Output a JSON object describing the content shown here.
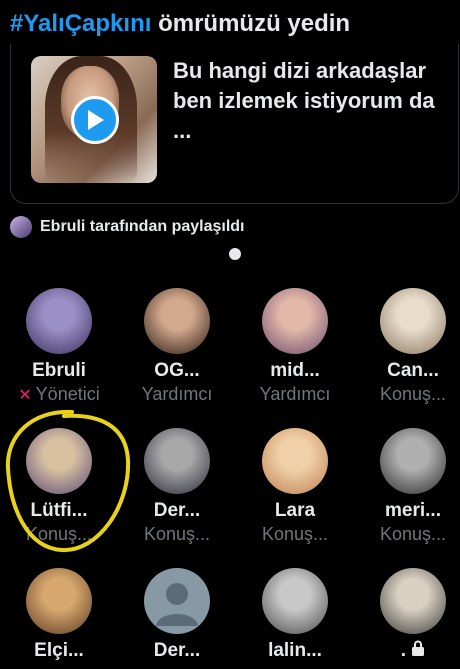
{
  "header": {
    "hashtag": "#YalıÇapkını",
    "rest": "ömrümüzü yedin"
  },
  "card": {
    "text": "Bu hangi dizi arkadaşlar ben izlemek istiyorum da ...",
    "thumbnail": "video-thumbnail",
    "play_icon": "play-icon"
  },
  "shared": {
    "text": "Ebruli tarafından paylaşıldı"
  },
  "colors": {
    "accent": "#1d9bf0",
    "host": "#f91880",
    "highlight": "#e8d21a",
    "muted": "#71767b"
  },
  "members": [
    {
      "name": "Ebruli",
      "role": "Yönetici",
      "role_icon": "host-icon",
      "palette": [
        "#9b8fc7",
        "#3a2f5a"
      ]
    },
    {
      "name": "OG...",
      "role": "Yardımcı",
      "palette": [
        "#d3a98d",
        "#2b1a14"
      ]
    },
    {
      "name": "mid...",
      "role": "Yardımcı",
      "palette": [
        "#e2b8a8",
        "#6b4a6e"
      ]
    },
    {
      "name": "Can...",
      "role": "Konuş...",
      "palette": [
        "#e8dccb",
        "#8a7560"
      ]
    },
    {
      "name": "Lütfi...",
      "role": "Konuş...",
      "palette": [
        "#d9c0a0",
        "#5a4a78"
      ]
    },
    {
      "name": "Der...",
      "role": "Konuş...",
      "palette": [
        "#a8a8a8",
        "#2a2a3a"
      ]
    },
    {
      "name": "Lara",
      "role": "Konuş...",
      "palette": [
        "#f0d0a8",
        "#c08050"
      ]
    },
    {
      "name": "meri...",
      "role": "Konuş...",
      "palette": [
        "#b0b0b0",
        "#2a2a2a"
      ]
    },
    {
      "name": "Elçi...",
      "role": "",
      "palette": [
        "#d9a870",
        "#5a3a20"
      ]
    },
    {
      "name": "Der...",
      "role": "",
      "default_avatar": true,
      "palette": [
        "#8899a6",
        "#5c6b78"
      ]
    },
    {
      "name": "lalin...",
      "role": "",
      "palette": [
        "#c8c8c8",
        "#4a4a4a"
      ]
    },
    {
      "name": ".",
      "role": "",
      "lock": true,
      "palette": [
        "#d8d0c0",
        "#3a3a3a"
      ]
    }
  ]
}
